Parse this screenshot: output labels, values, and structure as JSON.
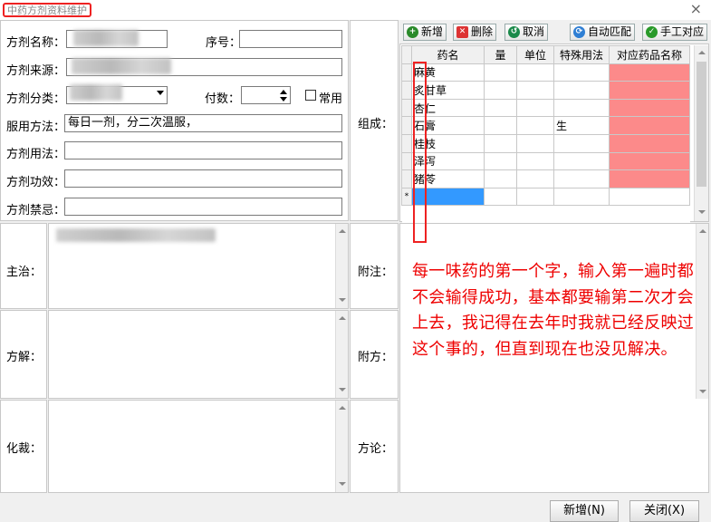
{
  "window": {
    "title": "中药方剂资料维护",
    "close_glyph": "×"
  },
  "form": {
    "name_label": "方剂名称：",
    "seq_label": "序号：",
    "source_label": "方剂来源：",
    "category_label": "方剂分类：",
    "doses_label": "付数：",
    "common_label": "常用",
    "usage_label": "服用方法：",
    "usage_value": "每日一剂，分二次温服，",
    "method_label": "方剂用法：",
    "efficacy_label": "方剂功效：",
    "taboo_label": "方剂禁忌："
  },
  "composition": {
    "label": "组成：",
    "toolbar": {
      "add": "新增",
      "delete": "删除",
      "cancel": "取消",
      "auto_match": "自动匹配",
      "manual_match": "手工对应"
    },
    "columns": [
      "药名",
      "量",
      "单位",
      "特殊用法",
      "对应药品名称"
    ],
    "rows": [
      {
        "name": "麻黄",
        "special": ""
      },
      {
        "name": "炙甘草",
        "special": ""
      },
      {
        "name": "杏仁",
        "special": ""
      },
      {
        "name": "石膏",
        "special": "生"
      },
      {
        "name": "桂枝",
        "special": ""
      },
      {
        "name": "泽泻",
        "special": ""
      },
      {
        "name": "猪苓",
        "special": ""
      }
    ],
    "new_row_marker": "*"
  },
  "sections": {
    "indications": "主治：",
    "explanation": "方解：",
    "adaptation": "化裁：",
    "notes": "附注：",
    "attached": "附方：",
    "discussion": "方论："
  },
  "annotation": "每一味药的第一个字，输入第一遍时都不会输得成功，基本都要输第二次才会上去，我记得在去年时我就已经反映过这个事的，但直到现在也没见解决。",
  "buttons": {
    "new": "新增(N)",
    "close": "关闭(X)"
  },
  "colors": {
    "accent_red": "#e22222",
    "match_cell": "#fc8a8a",
    "selection": "#3399ff"
  },
  "icons": {
    "add": "plus-circle-icon",
    "delete": "x-icon",
    "cancel": "undo-icon",
    "auto_match": "refresh-icon",
    "manual_match": "check-icon"
  }
}
